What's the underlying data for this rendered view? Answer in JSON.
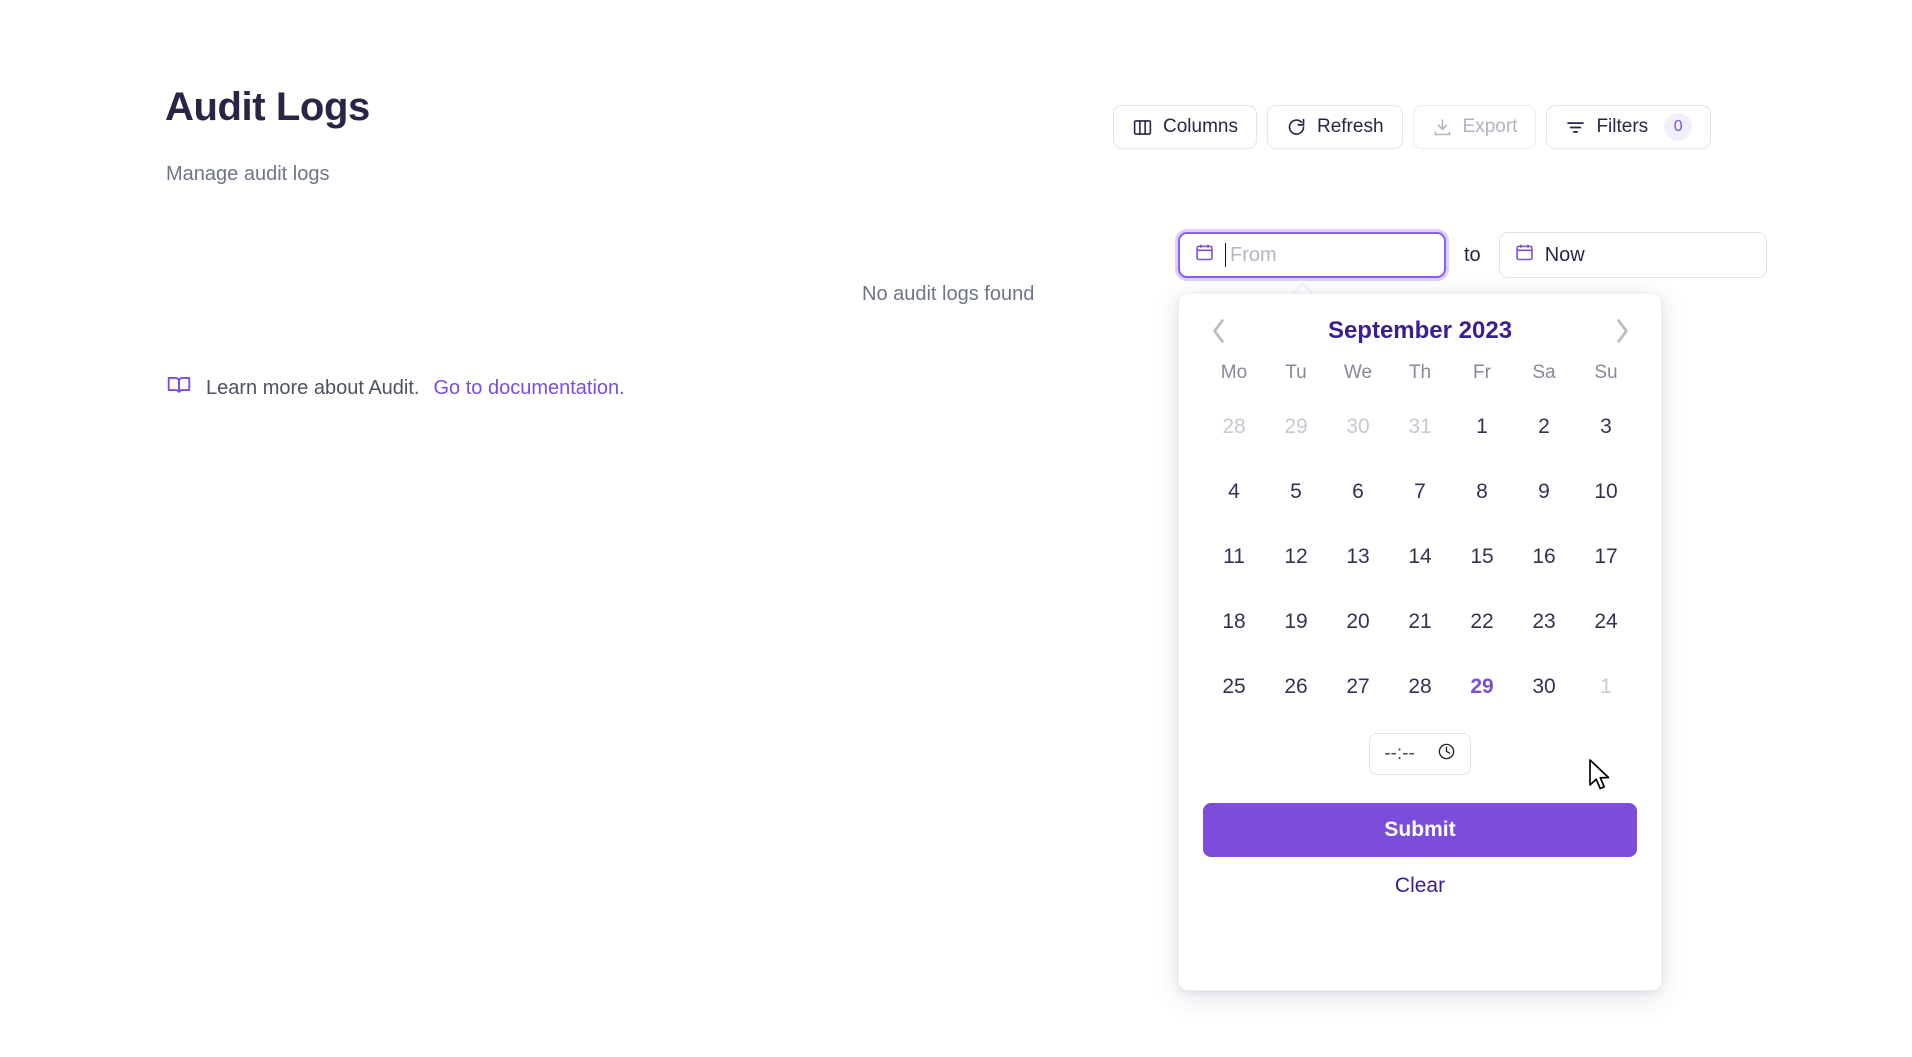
{
  "header": {
    "title": "Audit Logs",
    "subtitle": "Manage audit logs"
  },
  "toolbar": {
    "columns_label": "Columns",
    "refresh_label": "Refresh",
    "export_label": "Export",
    "filters_label": "Filters",
    "filters_count": "0"
  },
  "main": {
    "empty_message": "No audit logs found",
    "learn_more_text": "Learn more about Audit.",
    "documentation_link": "Go to documentation."
  },
  "date_range": {
    "from_placeholder": "From",
    "from_value": "",
    "separator_label": "to",
    "to_value": "Now"
  },
  "calendar": {
    "month_title": "September 2023",
    "prev_icon": "chevron-left-icon",
    "next_icon": "chevron-right-icon",
    "weekdays": [
      "Mo",
      "Tu",
      "We",
      "Th",
      "Fr",
      "Sa",
      "Su"
    ],
    "days": [
      {
        "n": "28",
        "state": "muted"
      },
      {
        "n": "29",
        "state": "muted"
      },
      {
        "n": "30",
        "state": "muted"
      },
      {
        "n": "31",
        "state": "muted"
      },
      {
        "n": "1",
        "state": "normal"
      },
      {
        "n": "2",
        "state": "normal"
      },
      {
        "n": "3",
        "state": "normal"
      },
      {
        "n": "4",
        "state": "normal"
      },
      {
        "n": "5",
        "state": "normal"
      },
      {
        "n": "6",
        "state": "normal"
      },
      {
        "n": "7",
        "state": "normal"
      },
      {
        "n": "8",
        "state": "normal"
      },
      {
        "n": "9",
        "state": "normal"
      },
      {
        "n": "10",
        "state": "normal"
      },
      {
        "n": "11",
        "state": "normal"
      },
      {
        "n": "12",
        "state": "normal"
      },
      {
        "n": "13",
        "state": "normal"
      },
      {
        "n": "14",
        "state": "normal"
      },
      {
        "n": "15",
        "state": "normal"
      },
      {
        "n": "16",
        "state": "normal"
      },
      {
        "n": "17",
        "state": "normal"
      },
      {
        "n": "18",
        "state": "normal"
      },
      {
        "n": "19",
        "state": "normal"
      },
      {
        "n": "20",
        "state": "normal"
      },
      {
        "n": "21",
        "state": "normal"
      },
      {
        "n": "22",
        "state": "normal"
      },
      {
        "n": "23",
        "state": "normal"
      },
      {
        "n": "24",
        "state": "normal"
      },
      {
        "n": "25",
        "state": "normal"
      },
      {
        "n": "26",
        "state": "normal"
      },
      {
        "n": "27",
        "state": "normal"
      },
      {
        "n": "28",
        "state": "normal"
      },
      {
        "n": "29",
        "state": "today"
      },
      {
        "n": "30",
        "state": "normal"
      },
      {
        "n": "1",
        "state": "muted"
      }
    ],
    "time_value": "--:--",
    "submit_label": "Submit",
    "clear_label": "Clear"
  },
  "colors": {
    "accent": "#7c4ddb",
    "accent_dark": "#3b1f8f",
    "title": "#2b2447",
    "muted_text": "#6d7588"
  }
}
